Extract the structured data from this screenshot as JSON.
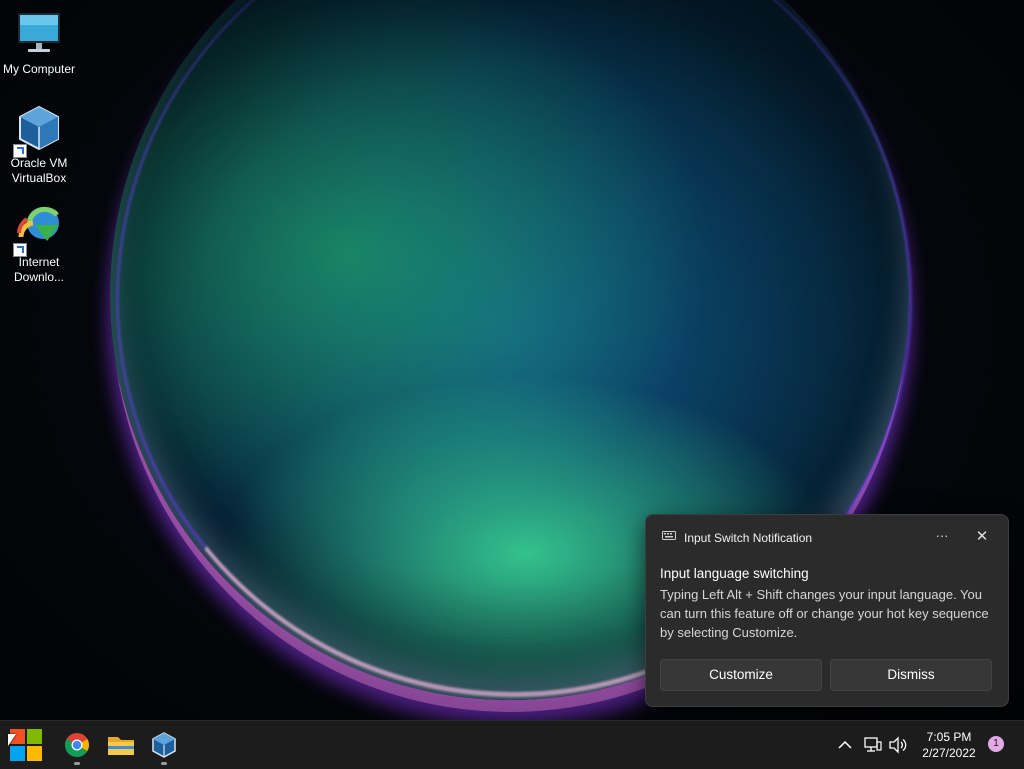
{
  "desktop": {
    "icons": [
      {
        "label_line1": "My Computer",
        "label_line2": "",
        "icon": "monitor-icon"
      },
      {
        "label_line1": "Oracle VM",
        "label_line2": "VirtualBox",
        "icon": "virtualbox-icon"
      },
      {
        "label_line1": "Internet",
        "label_line2": "Downlo...",
        "icon": "internet-download-manager-icon"
      }
    ]
  },
  "notification": {
    "app_name": "Input Switch Notification",
    "more_label": "···",
    "close_label": "✕",
    "title": "Input language switching",
    "body": "Typing Left Alt + Shift changes your input language. You can turn this feature off or change your hot key sequence by selecting Customize.",
    "customize_label": "Customize",
    "dismiss_label": "Dismiss"
  },
  "taskbar": {
    "apps": [
      "start-icon",
      "chrome-icon",
      "file-explorer-icon",
      "virtualbox-icon"
    ],
    "tray": {
      "chevron": "^",
      "time": "7:05 PM",
      "date": "2/27/2022",
      "notification_count": "1"
    }
  },
  "colors": {
    "taskbar_bg": "#1c1c1c",
    "toast_bg": "#2b2b2b",
    "badge": "#e2a9e6"
  }
}
